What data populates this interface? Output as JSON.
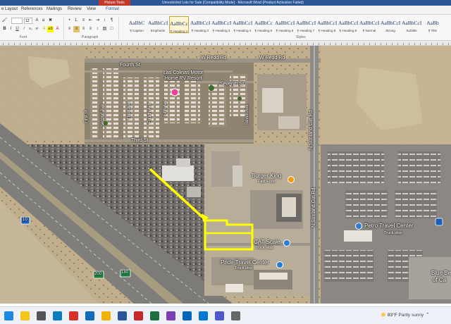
{
  "window": {
    "title": "Unrestricted Lots for Sale [Compatibility Mode] - Microsoft Word (Product Activation Failed)",
    "context_tab": "Picture Tools"
  },
  "ribbon": {
    "tabs": [
      "e Layout",
      "References",
      "Mailings",
      "Review",
      "View",
      "Format"
    ],
    "active_tab": "Format",
    "font_name": "",
    "font_size": "12",
    "groups": {
      "font": "Font",
      "paragraph": "Paragraph",
      "styles": "Styles"
    },
    "styles": [
      {
        "sample": "AaBbC",
        "name": "¶ Caption"
      },
      {
        "sample": "AaBbCcI",
        "name": "Emphasis"
      },
      {
        "sample": "AaBbCc",
        "name": "¶ Heading 1"
      },
      {
        "sample": "AaBbCcI",
        "name": "¶ Heading 2"
      },
      {
        "sample": "AaBbCcI",
        "name": "¶ Heading 3"
      },
      {
        "sample": "AaBbCcI",
        "name": "¶ Heading 4"
      },
      {
        "sample": "AaBbCc",
        "name": "¶ Heading 5"
      },
      {
        "sample": "AaBbCcDc",
        "name": "¶ Heading 6"
      },
      {
        "sample": "AaBbCcDc",
        "name": "¶ Heading 7"
      },
      {
        "sample": "AaBbCcDc",
        "name": "¶ Heading 8"
      },
      {
        "sample": "AaBbCcDc",
        "name": "¶ Heading 9"
      },
      {
        "sample": "AaBbCcDc",
        "name": "¶ Normal"
      },
      {
        "sample": "AaBbCcDd",
        "name": "Strong"
      },
      {
        "sample": "AaBbCcI",
        "name": "Subtitle"
      },
      {
        "sample": "AaBb",
        "name": "¶ Title"
      }
    ]
  },
  "map": {
    "labels": {
      "w_redd_rd_1": "W Redd Rd",
      "w_redd_rd_2": "W Redd Rd",
      "fourth_st": "Fourth St",
      "third_st": "Third St",
      "seventh_st": "Seventh St",
      "first_st": "First St",
      "second_ave": "Second Ave",
      "third_ave": "Third Ave",
      "fourth_ave": "Fourth Ave",
      "fifth_ave": "Fifth Ave",
      "sixth_ave": "Sixth Ave",
      "seven_ave": "Seven Ave",
      "las_colinas": "Las Colinas Motor\nHome RV Resort",
      "n_sunland_gin_rd_1": "N Sunland Gin Rd",
      "n_sunland_gin_rd_2": "N Sunland Gin Rd",
      "burger_king": "Burger King",
      "fast_food": "Fast Food",
      "petro": "Petro Travel Center",
      "truck_stop_1": "Truck stop",
      "cat_scale": "CAT Scale",
      "truck_stop_2": "Truck stop",
      "pride": "Pride Travel Center",
      "truck_stop_3": "Truck stop",
      "blue_beacon": "Blue Be",
      "blue_beacon_2": "of Ca",
      "route_10": "10",
      "route_200": "200",
      "route_180": "180"
    },
    "colors": {
      "desert": "#b6a588",
      "highlight": "#ffff00",
      "road": "#8a8a8a",
      "highway_shield": "#1e7f3f",
      "interstate_shield": "#1f5fb8"
    }
  },
  "taskbar": {
    "temperature": "83°F",
    "condition": "Partly sunny",
    "icons": [
      "start-icon",
      "sparkle-icon",
      "search-icon",
      "edge-icon",
      "chrome-icon",
      "mail-icon",
      "explorer-icon",
      "word-icon",
      "pdf-icon",
      "excel-icon",
      "photos-icon",
      "store-icon",
      "calendar-icon",
      "teams-icon",
      "settings-icon"
    ]
  }
}
